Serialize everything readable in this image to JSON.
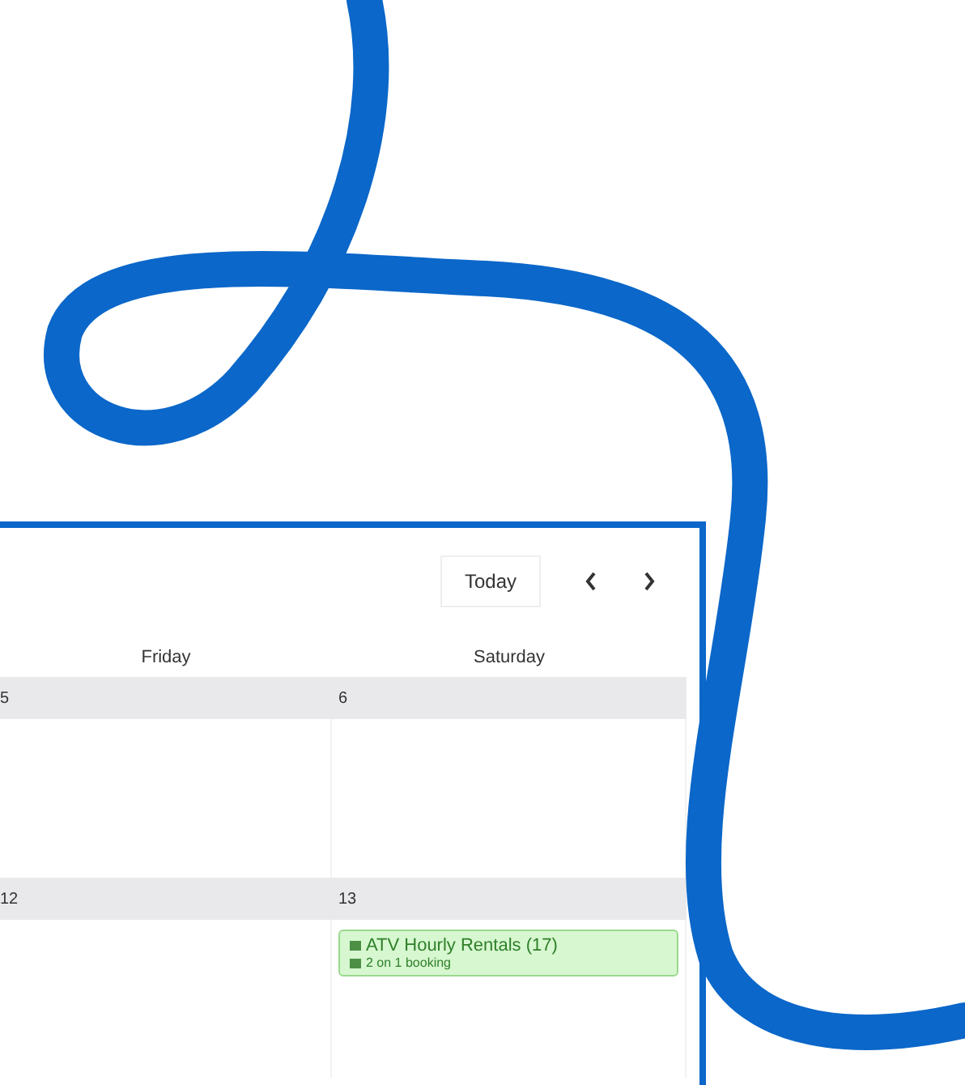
{
  "toolbar": {
    "today_button": "Today"
  },
  "columns": [
    "Friday",
    "Saturday"
  ],
  "weeks": [
    {
      "days": [
        {
          "date": "5"
        },
        {
          "date": "6"
        }
      ]
    },
    {
      "days": [
        {
          "date": "12"
        },
        {
          "date": "13",
          "events": [
            {
              "title": "ATV Hourly Rentals (17)",
              "detail": "2 on 1 booking"
            }
          ]
        }
      ]
    }
  ]
}
